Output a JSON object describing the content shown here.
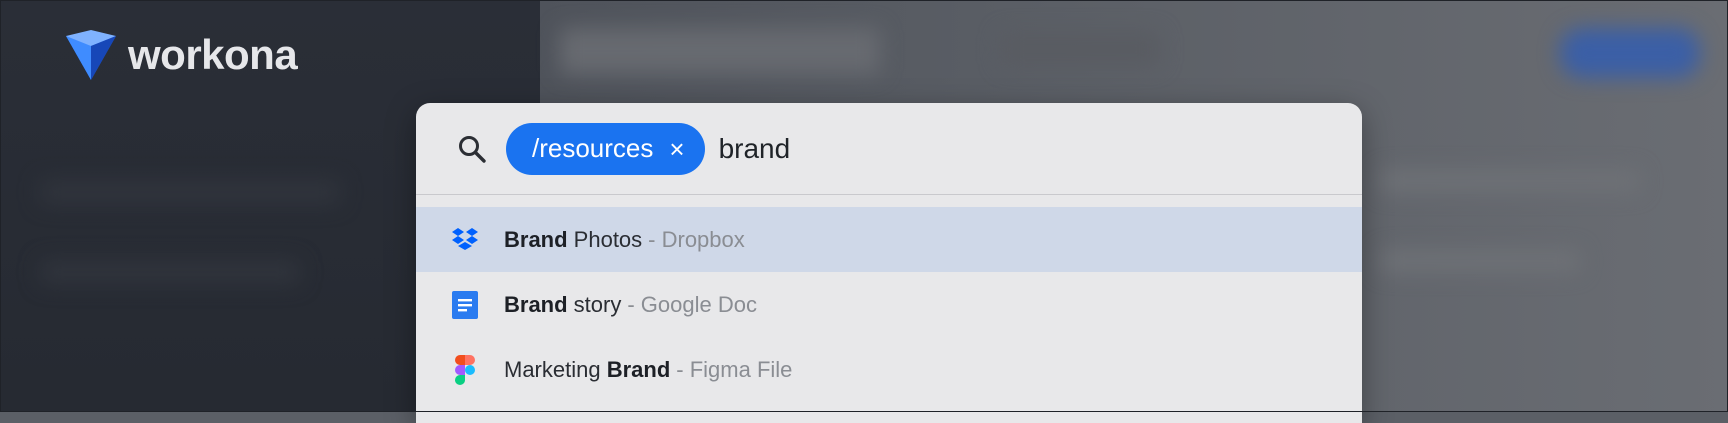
{
  "brand": {
    "name": "workona"
  },
  "search": {
    "filter_chip": "/resources",
    "chip_close": "×",
    "query": "brand"
  },
  "results": [
    {
      "bold": "Brand",
      "rest": " Photos",
      "source": "- Dropbox",
      "icon": "dropbox-icon",
      "selected": true
    },
    {
      "bold": "Brand",
      "rest": " story",
      "source": "- Google Doc",
      "icon": "google-doc-icon",
      "selected": false
    },
    {
      "pre": "Marketing ",
      "bold": "Brand",
      "source": "- Figma File",
      "icon": "figma-icon",
      "selected": false
    }
  ],
  "colors": {
    "accent": "#1a73f0",
    "selected_row": "#cfd8e8",
    "palette_bg": "#e8e8ea"
  }
}
